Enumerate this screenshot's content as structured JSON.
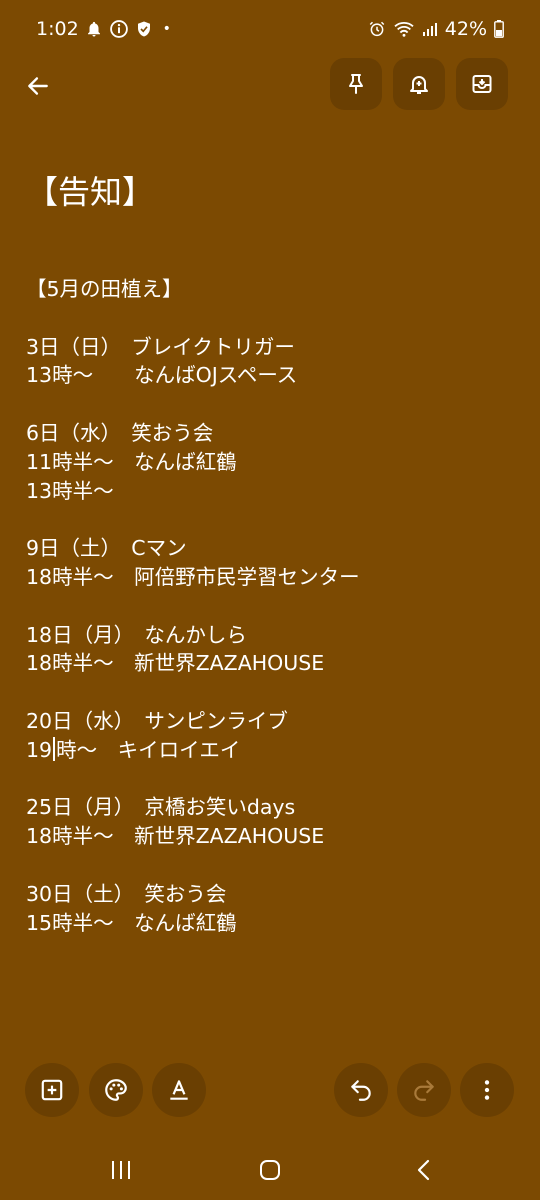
{
  "status_bar": {
    "time": "1:02",
    "battery": "42%",
    "dot": "•",
    "left_icons": [
      "bell-icon",
      "info-icon",
      "shield-icon"
    ],
    "right_icons": [
      "alarm-icon",
      "wifi-icon",
      "signal-icon",
      "battery-icon"
    ]
  },
  "toolbar": {
    "back_icon": "arrow-left-icon",
    "actions": [
      "pin-icon",
      "reminder-bell-icon",
      "archive-icon"
    ]
  },
  "note": {
    "title": "【告知】",
    "lines": [
      "【5月の田植え】",
      "",
      "3日（日）　ブレイクトリガー",
      "13時〜　　なんばOJスペース",
      "",
      "6日（水）　笑おう会",
      "11時半〜　なんば紅鶴",
      "13時半〜",
      "",
      "9日（土）　Cマン",
      "18時半〜　阿倍野市民学習センター",
      "",
      "18日（月）　なんかしら",
      "18時半〜　新世界ZAZAHOUSE",
      "",
      "20日（水）　サンピンライブ",
      "",
      "",
      "25日（月）　京橋お笑いdays",
      "18時半〜　新世界ZAZAHOUSE",
      "",
      "30日（土）　笑おう会",
      "15時半〜　なんば紅鶴"
    ],
    "caret_line_before": "19",
    "caret_line_after": "時〜　キイロイエイ"
  },
  "bottom_toolbar": {
    "left": [
      "add-box-icon",
      "palette-icon",
      "text-format-icon"
    ],
    "right": [
      "undo-icon",
      "redo-icon",
      "more-vert-icon"
    ]
  },
  "nav": [
    "recent-apps-icon",
    "home-icon",
    "back-nav-icon"
  ]
}
